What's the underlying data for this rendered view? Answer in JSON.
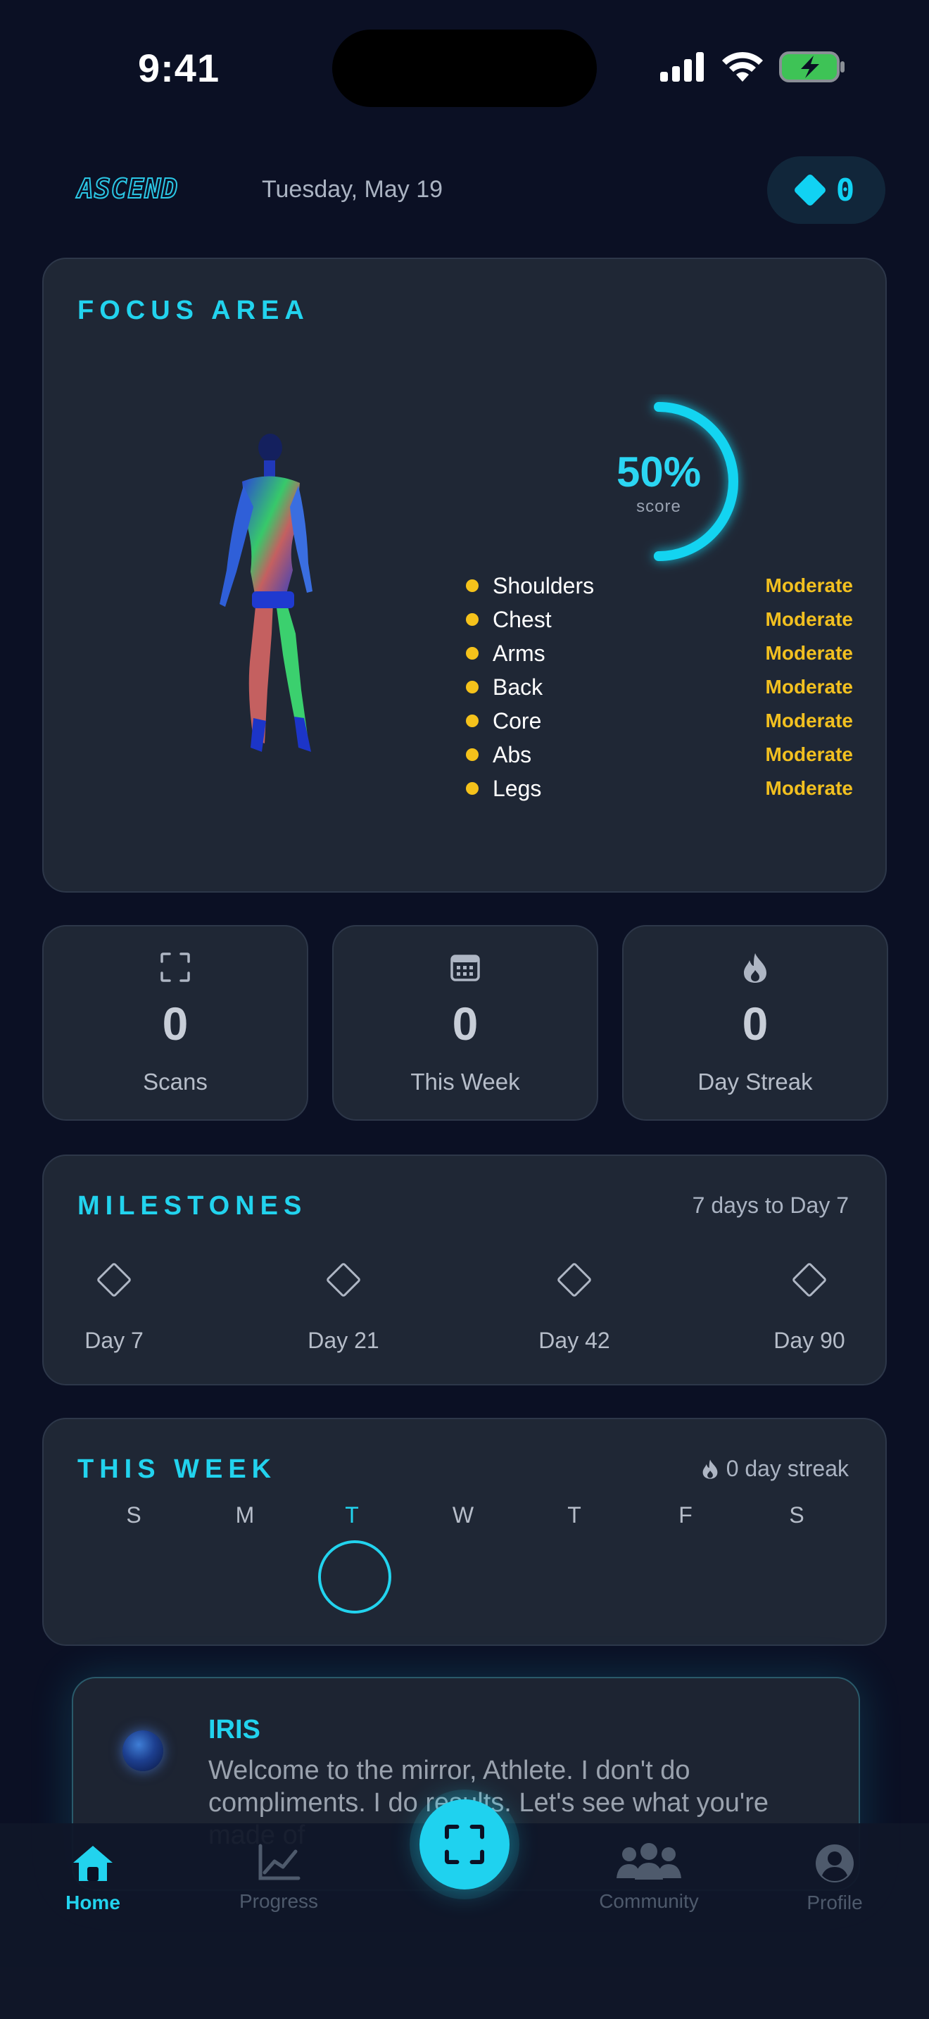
{
  "status_bar": {
    "time": "9:41"
  },
  "header": {
    "logo": "ASCEND",
    "date": "Tuesday, May 19",
    "gems": "0"
  },
  "focus_area": {
    "title": "FOCUS AREA",
    "score_value": "50%",
    "score_label": "score",
    "score_fraction": 0.5,
    "muscles": [
      {
        "name": "Shoulders",
        "level": "Moderate"
      },
      {
        "name": "Chest",
        "level": "Moderate"
      },
      {
        "name": "Arms",
        "level": "Moderate"
      },
      {
        "name": "Back",
        "level": "Moderate"
      },
      {
        "name": "Core",
        "level": "Moderate"
      },
      {
        "name": "Abs",
        "level": "Moderate"
      },
      {
        "name": "Legs",
        "level": "Moderate"
      }
    ]
  },
  "stats": [
    {
      "value": "0",
      "label": "Scans",
      "icon": "scan-frame-icon"
    },
    {
      "value": "0",
      "label": "This Week",
      "icon": "calendar-icon"
    },
    {
      "value": "0",
      "label": "Day Streak",
      "icon": "flame-icon"
    }
  ],
  "milestones": {
    "title": "MILESTONES",
    "subtitle": "7 days to Day 7",
    "items": [
      "Day 7",
      "Day 21",
      "Day 42",
      "Day 90"
    ]
  },
  "this_week": {
    "title": "THIS WEEK",
    "streak": "0 day streak",
    "days": [
      "S",
      "M",
      "T",
      "W",
      "T",
      "F",
      "S"
    ],
    "today_index": 2
  },
  "iris": {
    "title": "IRIS",
    "message": "Welcome to the mirror, Athlete. I don't do compliments. I do results. Let's see what you're made of"
  },
  "tabbar": {
    "home": "Home",
    "progress": "Progress",
    "community": "Community",
    "profile": "Profile"
  },
  "colors": {
    "accent": "#22d3ee",
    "warning": "#f2c020",
    "background": "#0b1024",
    "card": "#1f2735"
  }
}
